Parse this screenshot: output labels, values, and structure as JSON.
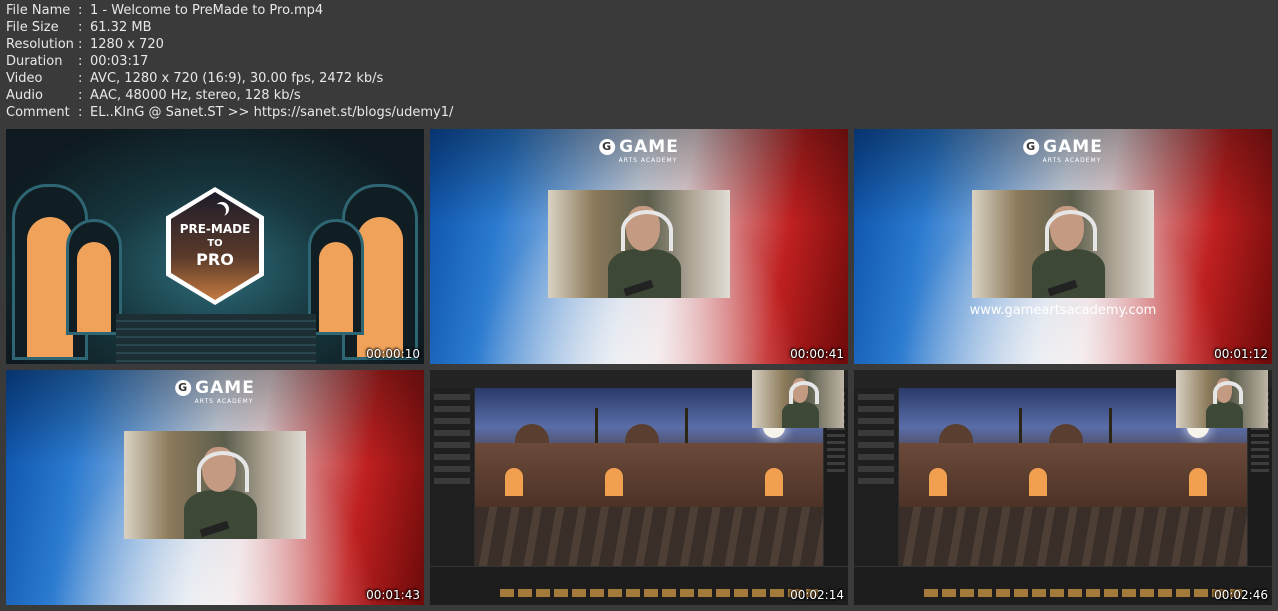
{
  "info": [
    {
      "key": "File Name",
      "value": "1 - Welcome to PreMade to Pro.mp4"
    },
    {
      "key": "File Size",
      "value": "61.32 MB"
    },
    {
      "key": "Resolution",
      "value": "1280 x 720"
    },
    {
      "key": "Duration",
      "value": "00:03:17"
    },
    {
      "key": "Video",
      "value": "AVC, 1280 x 720 (16:9), 30.00 fps, 2472 kb/s"
    },
    {
      "key": "Audio",
      "value": "AAC, 48000 Hz, stereo, 128 kb/s"
    },
    {
      "key": "Comment",
      "value": "EL..KInG @ Sanet.ST >> https://sanet.st/blogs/udemy1/"
    }
  ],
  "separator": ":",
  "brand": {
    "logo_word": "GAME",
    "logo_sub": "ARTS ACADEMY",
    "logo_glyph": "G",
    "website": "www.gameartsacademy.com"
  },
  "premade_logo": {
    "line1": "PRE-MADE",
    "line2": "TO",
    "line3": "PRO"
  },
  "thumbnails": [
    {
      "kind": "premade-title",
      "timestamp": "00:00:10"
    },
    {
      "kind": "instructor-cam",
      "timestamp": "00:00:41"
    },
    {
      "kind": "instructor-cam-website",
      "timestamp": "00:01:12"
    },
    {
      "kind": "instructor-cam",
      "timestamp": "00:01:43"
    },
    {
      "kind": "unreal-editor",
      "timestamp": "00:02:14"
    },
    {
      "kind": "unreal-editor",
      "timestamp": "00:02:46"
    }
  ],
  "colors": {
    "background": "#3a3a3a",
    "text": "#e8e8e8",
    "accent_blue": "#0b4fa8",
    "accent_red": "#c02020"
  }
}
